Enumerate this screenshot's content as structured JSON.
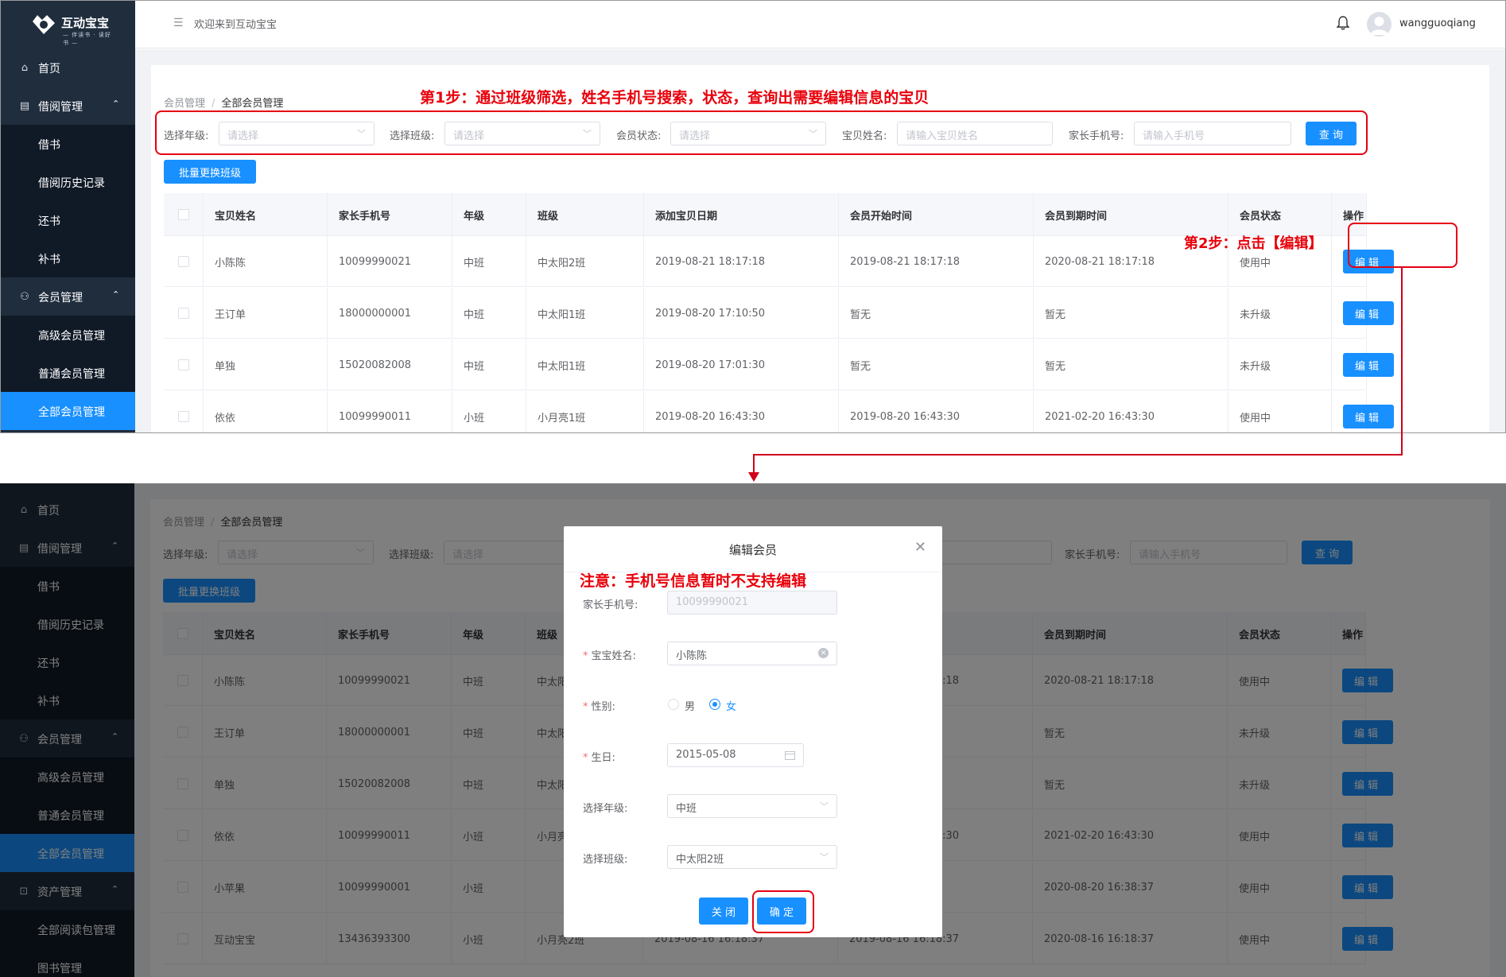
{
  "app": {
    "logo_text": "互动宝宝",
    "logo_sub": "— 伴读书 · 读好书 —",
    "welcome": "欢迎来到互动宝宝",
    "username": "wangguoqiang"
  },
  "sidebar": {
    "top": [
      {
        "label": "首页",
        "icon": "home-icon"
      },
      {
        "label": "借阅管理",
        "icon": "book-icon",
        "expanded": true
      },
      {
        "label": "借书"
      },
      {
        "label": "借阅历史记录"
      },
      {
        "label": "还书"
      },
      {
        "label": "补书"
      },
      {
        "label": "会员管理",
        "icon": "users-icon",
        "expanded": true
      },
      {
        "label": "高级会员管理"
      },
      {
        "label": "普通会员管理"
      },
      {
        "label": "全部会员管理",
        "active": true
      }
    ],
    "extra": [
      {
        "label": "资产管理",
        "icon": "asset-icon"
      },
      {
        "label": "全部阅读包管理"
      },
      {
        "label": "图书管理"
      }
    ]
  },
  "breadcrumb": {
    "parent": "会员管理",
    "current": "全部会员管理"
  },
  "filters": {
    "grade_label": "选择年级:",
    "class_label": "选择班级:",
    "status_label": "会员状态:",
    "name_label": "宝贝姓名:",
    "phone_label": "家长手机号:",
    "select_placeholder": "请选择",
    "name_placeholder": "请输入宝贝姓名",
    "phone_placeholder": "请输入手机号",
    "query": "查 询",
    "batch": "批量更换班级"
  },
  "table": {
    "headers": [
      "宝贝姓名",
      "家长手机号",
      "年级",
      "班级",
      "添加宝贝日期",
      "会员开始时间",
      "会员到期时间",
      "会员状态",
      "操作"
    ],
    "edit_label": "编辑",
    "rows": [
      [
        "小陈陈",
        "10099990021",
        "中班",
        "中太阳2班",
        "2019-08-21 18:17:18",
        "2019-08-21 18:17:18",
        "2020-08-21 18:17:18",
        "使用中"
      ],
      [
        "王订单",
        "18000000001",
        "中班",
        "中太阳1班",
        "2019-08-20 17:10:50",
        "暂无",
        "暂无",
        "未升级"
      ],
      [
        "单独",
        "15020082008",
        "中班",
        "中太阳1班",
        "2019-08-20 17:01:30",
        "暂无",
        "暂无",
        "未升级"
      ],
      [
        "依依",
        "10099990011",
        "小班",
        "小月亮1班",
        "2019-08-20 16:43:30",
        "2019-08-20 16:43:30",
        "2021-02-20 16:43:30",
        "使用中"
      ],
      [
        "小苹果",
        "10099990001",
        "小班",
        "",
        "",
        "",
        "2020-08-20 16:38:37",
        "使用中"
      ],
      [
        "互动宝宝",
        "13436393300",
        "小班",
        "小月亮2班",
        "2019-08-16 16:18:37",
        "2019-08-16 16:18:37",
        "2020-08-16 16:18:37",
        "使用中"
      ]
    ],
    "bottom_partial_times": [
      "17:18",
      "",
      "",
      "43:30",
      "38:37",
      ""
    ]
  },
  "annotations": {
    "step1": "第1步：通过班级筛选，姓名手机号搜索，状态，查询出需要编辑信息的宝贝",
    "step2": "第2步：点击【编辑】",
    "note": "注意：手机号信息暂时不支持编辑"
  },
  "dialog": {
    "title": "编辑会员",
    "phone_label": "家长手机号:",
    "phone_value": "10099990021",
    "name_label": "宝宝姓名:",
    "name_value": "小陈陈",
    "gender_label": "性别:",
    "gender_male": "男",
    "gender_female": "女",
    "birthday_label": "生日:",
    "birthday_value": "2015-05-08",
    "grade_label": "选择年级:",
    "grade_value": "中班",
    "class_label": "选择班级:",
    "class_value": "中太阳2班",
    "close_btn": "关 闭",
    "confirm_btn": "确 定"
  },
  "colors": {
    "primary": "#1890ff",
    "sidebar": "#1f2d3d",
    "annotation": "#e8000b"
  }
}
